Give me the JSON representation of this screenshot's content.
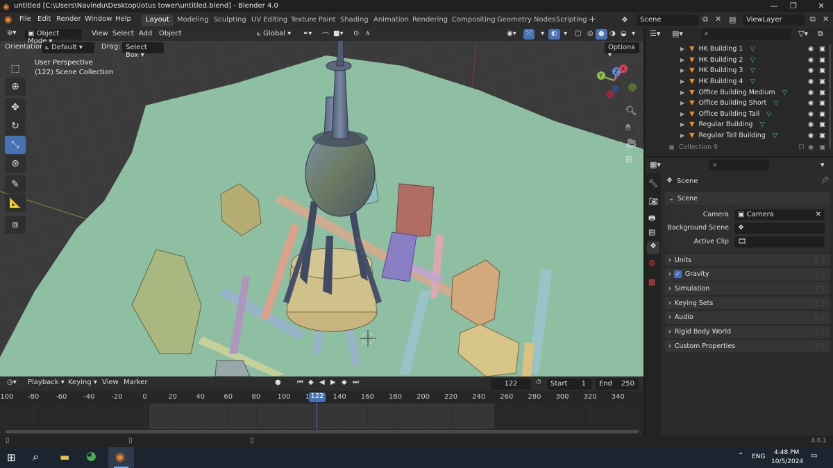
{
  "window": {
    "title": "untitled [C:\\Users\\Navindu\\Desktop\\lotus tower\\untitled.blend] - Blender 4.0",
    "min": "—",
    "max": "❐",
    "close": "✕"
  },
  "menu": [
    "File",
    "Edit",
    "Render",
    "Window",
    "Help"
  ],
  "workspaces": [
    "Layout",
    "Modeling",
    "Sculpting",
    "UV Editing",
    "Texture Paint",
    "Shading",
    "Animation",
    "Rendering",
    "Compositing",
    "Geometry Nodes",
    "Scripting"
  ],
  "active_workspace": "Layout",
  "scene_field": "Scene",
  "viewlayer_field": "ViewLayer",
  "viewport_header": {
    "mode": "Object Mode",
    "menus": [
      "View",
      "Select",
      "Add",
      "Object"
    ],
    "transform": "Global",
    "options": "Options",
    "orientation_label": "Orientation:",
    "orientation_value": "Default",
    "drag_label": "Drag:",
    "drag_value": "Select Box"
  },
  "viewport_info": {
    "line1": "User Perspective",
    "line2": "(122) Scene Collection"
  },
  "gizmo": {
    "x": "X",
    "y": "Y",
    "z": "Z"
  },
  "outliner": {
    "items": [
      "HK Building 1",
      "HK Building 2",
      "HK Building 3",
      "HK Building 4",
      "Office Building Medium",
      "Office Building Short",
      "Office Building Tall",
      "Regular Building",
      "Regular Tall Building"
    ],
    "collection9": "Collection 9"
  },
  "properties": {
    "header": "Scene",
    "panel": "Scene",
    "camera_label": "Camera",
    "camera_value": "Camera",
    "bg_scene_label": "Background Scene",
    "active_clip_label": "Active Clip",
    "sections": [
      "Units",
      "Gravity",
      "Simulation",
      "Keying Sets",
      "Audio",
      "Rigid Body World",
      "Custom Properties"
    ],
    "gravity_checked": true
  },
  "timeline": {
    "menus": [
      "Playback",
      "Keying",
      "View",
      "Marker"
    ],
    "current_frame": "122",
    "start_label": "Start",
    "start": "1",
    "end_label": "End",
    "end": "250",
    "ticks": [
      "-100",
      "-80",
      "-60",
      "-40",
      "-20",
      "0",
      "20",
      "40",
      "60",
      "80",
      "100",
      "122",
      "140",
      "160",
      "180",
      "200",
      "220",
      "240",
      "260",
      "280",
      "300",
      "320",
      "340"
    ]
  },
  "status": {
    "version": "4.0.1"
  },
  "taskbar": {
    "lang": "ENG",
    "time": "4:48 PM",
    "date": "10/5/2024"
  },
  "colors": {
    "accent": "#4772b3",
    "ground": "#8fbfa2",
    "playhead": "#4772b3"
  }
}
